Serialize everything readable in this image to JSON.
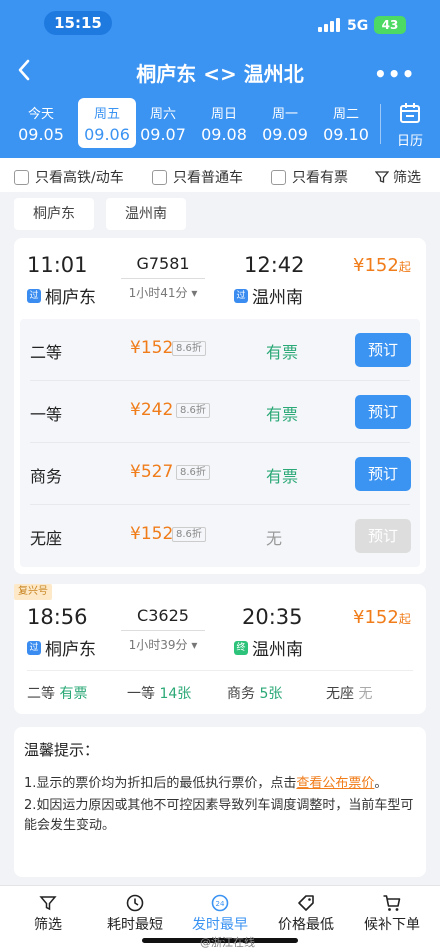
{
  "status": {
    "time": "15:15",
    "network": "5G",
    "battery": "43"
  },
  "header": {
    "title": "桐庐东 <> 温州北"
  },
  "dates": [
    {
      "week": "今天",
      "date": "09.05"
    },
    {
      "week": "周五",
      "date": "09.06",
      "selected": true
    },
    {
      "week": "周六",
      "date": "09.07"
    },
    {
      "week": "周日",
      "date": "09.08"
    },
    {
      "week": "周一",
      "date": "09.09"
    },
    {
      "week": "周二",
      "date": "09.10"
    }
  ],
  "calendar_label": "日历",
  "filters": {
    "high_speed": "只看高铁/动车",
    "normal": "只看普通车",
    "available": "只看有票",
    "filter": "筛选"
  },
  "station_chips": [
    "桐庐东",
    "温州南"
  ],
  "trains": [
    {
      "depart_time": "11:01",
      "depart_station": "桐庐东",
      "depart_tag": "过",
      "train_no": "G7581",
      "duration": "1小时41分",
      "arrive_time": "12:42",
      "arrive_station": "温州南",
      "arrive_tag": "过",
      "price": "¥152",
      "price_suffix": "起",
      "seats": [
        {
          "name": "二等",
          "price": "¥152",
          "discount": "8.6折",
          "status": "有票",
          "book": "预订"
        },
        {
          "name": "一等",
          "price": "¥242",
          "discount": "8.6折",
          "status": "有票",
          "book": "预订"
        },
        {
          "name": "商务",
          "price": "¥527",
          "discount": "8.6折",
          "status": "有票",
          "book": "预订"
        },
        {
          "name": "无座",
          "price": "¥152",
          "discount": "8.6折",
          "status": "无",
          "book": "预订"
        }
      ]
    },
    {
      "badge": "复兴号",
      "depart_time": "18:56",
      "depart_station": "桐庐东",
      "depart_tag": "过",
      "train_no": "C3625",
      "duration": "1小时39分",
      "arrive_time": "20:35",
      "arrive_station": "温州南",
      "arrive_tag": "终",
      "price": "¥152",
      "price_suffix": "起",
      "summary": [
        {
          "name": "二等",
          "value": "有票"
        },
        {
          "name": "一等",
          "value": "14张"
        },
        {
          "name": "商务",
          "value": "5张"
        },
        {
          "name": "无座",
          "value": "无"
        }
      ]
    }
  ],
  "tips": {
    "title": "温馨提示：",
    "line1_a": "1.显示的票价均为折扣后的最低执行票价，点击",
    "line1_link": "查看公布票价",
    "line1_b": "。",
    "line2": "2.如因运力原因或其他不可控因素导致列车调度调整时，当前车型可能会发生变动。"
  },
  "tabbar": [
    {
      "label": "筛选",
      "icon": "filter-icon"
    },
    {
      "label": "耗时最短",
      "icon": "clock-icon"
    },
    {
      "label": "发时最早",
      "icon": "24h-icon",
      "active": true
    },
    {
      "label": "价格最低",
      "icon": "price-tag-icon"
    },
    {
      "label": "候补下单",
      "icon": "cart-icon"
    }
  ],
  "watermark": "@浙江在线",
  "colors": {
    "primary": "#3b93f2",
    "price": "#f07c1a",
    "available": "#2aa876"
  }
}
